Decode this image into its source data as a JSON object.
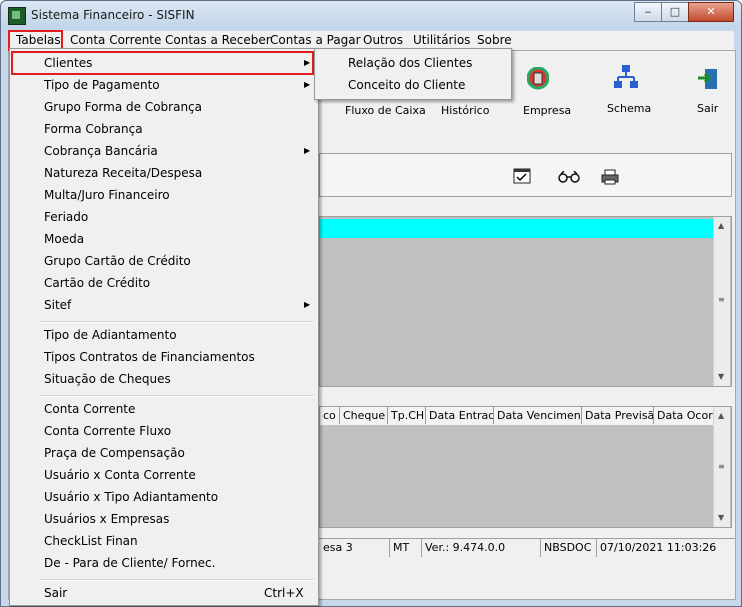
{
  "window": {
    "title": "Sistema Financeiro - SISFIN",
    "min": "‒",
    "max": "□",
    "close": "✕"
  },
  "menubar": [
    "Tabelas",
    "Conta Corrente",
    "Contas a Receber",
    "Contas a Pagar",
    "Outros",
    "Utilitários",
    "Sobre"
  ],
  "toolbar": {
    "fluxo": "Fluxo de Caixa",
    "historico": "Histórico",
    "empresa": "Empresa",
    "schema": "Schema",
    "sair": "Sair"
  },
  "lower_grid_headers": [
    "co",
    "Cheque",
    "Tp.CH",
    "Data Entrada",
    "Data Vencimento",
    "Data Previsão",
    "Data Ocorrê"
  ],
  "statusbar": [
    "esa 3",
    "MT",
    "Ver.: 9.474.0.0",
    "NBSDOC",
    "07/10/2021 11:03:26"
  ],
  "dropdown": {
    "items": [
      "Clientes",
      "Tipo de Pagamento",
      "Grupo Forma de Cobrança",
      "Forma Cobrança",
      "Cobrança Bancária",
      "Natureza Receita/Despesa",
      "Multa/Juro Financeiro",
      "Feriado",
      "Moeda",
      "Grupo Cartão de Crédito",
      "Cartão de Crédito",
      "Sitef",
      "Tipo de Adiantamento",
      "Tipos Contratos de Financiamentos",
      "Situação de Cheques",
      "Conta Corrente",
      "Conta Corrente Fluxo",
      "Praça de Compensação",
      "Usuário x Conta Corrente",
      "Usuário x Tipo Adiantamento",
      "Usuários x Empresas",
      "CheckList Finan",
      "De - Para de Cliente/ Fornec.",
      "Sair"
    ],
    "sair_shortcut": "Ctrl+X"
  },
  "submenu": [
    "Relação dos Clientes",
    "Conceito do Cliente"
  ],
  "colors": {
    "accent_cyan": "#00ffff",
    "highlight_red": "#e21d1d",
    "grid_gray": "#c0c0c0"
  },
  "icons": [
    "app-icon",
    "empresa-icon",
    "schema-icon",
    "sair-icon",
    "checklist-icon",
    "glasses-icon",
    "printer-icon"
  ]
}
